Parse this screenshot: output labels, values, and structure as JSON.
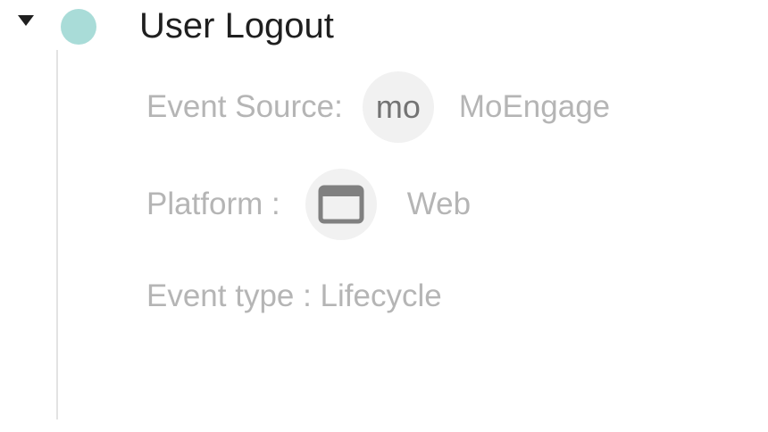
{
  "event": {
    "title": "User Logout",
    "status_color": "#a9dcd8",
    "expanded_icon": "caret-down-icon"
  },
  "details": {
    "source": {
      "label": "Event Source:",
      "badge": "mo",
      "value": "MoEngage"
    },
    "platform": {
      "label": "Platform :",
      "icon": "browser-window-icon",
      "value": "Web"
    },
    "type": {
      "text": "Event type : Lifecycle"
    }
  },
  "colors": {
    "title": "#1f1f1f",
    "muted_text": "#b5b5b5",
    "badge_text": "#737373",
    "badge_background": "#f1f1f1",
    "timeline": "#e3e3e3"
  }
}
